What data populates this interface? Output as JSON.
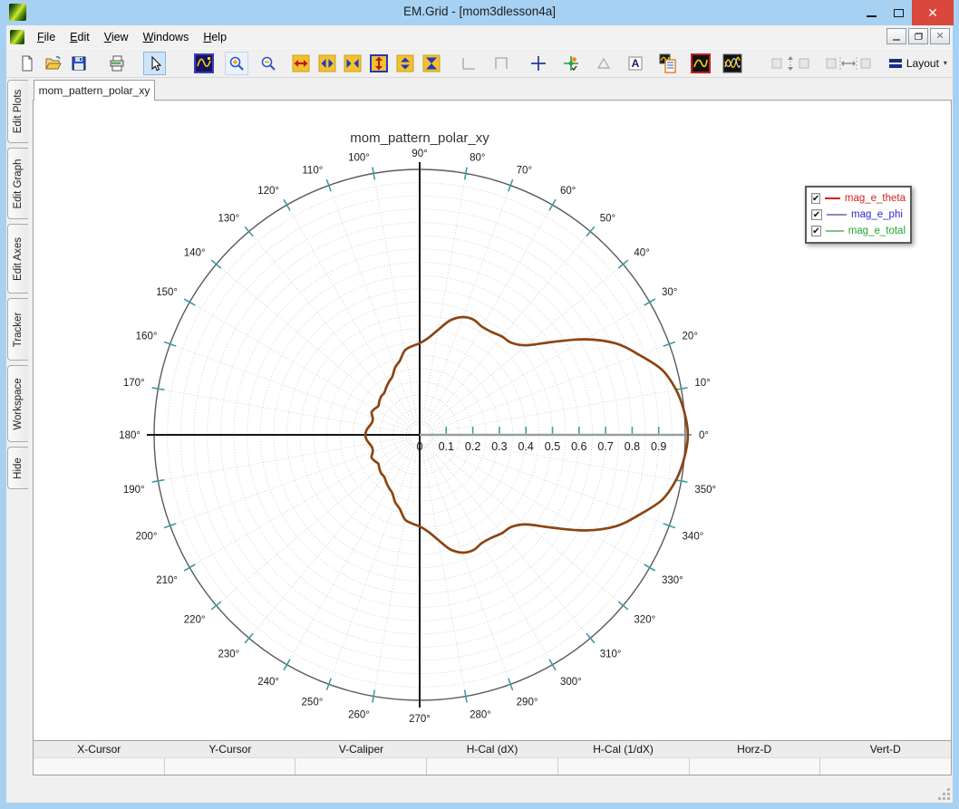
{
  "window": {
    "title": "EM.Grid - [mom3dlesson4a]"
  },
  "menubar": {
    "items": [
      "File",
      "Edit",
      "View",
      "Windows",
      "Help"
    ]
  },
  "toolbar": {
    "icons": [
      "new-file",
      "open-file",
      "save",
      "print",
      "pointer-tool",
      "fit-view",
      "zoom-in",
      "zoom-out",
      "expand-x",
      "pan-x",
      "compress-x",
      "expand-y",
      "pan-y",
      "compress-y",
      "corner-bottom-left",
      "corner-top",
      "crosshair",
      "tracker",
      "triangle",
      "text-annotation",
      "legend-list",
      "single-curve",
      "multi-curve",
      "y-scale-group",
      "x-scale-group"
    ],
    "layout_button": {
      "label": "Layout",
      "caret": "▾"
    }
  },
  "sidebar": {
    "items": [
      {
        "label": "Edit Plots"
      },
      {
        "label": "Edit Graph"
      },
      {
        "label": "Edit Axes"
      },
      {
        "label": "Tracker"
      },
      {
        "label": "Workspace"
      },
      {
        "label": "Hide"
      }
    ]
  },
  "document_tabs": {
    "active": "mom_pattern_polar_xy"
  },
  "legend": {
    "items": [
      {
        "label": "mag_e_theta",
        "checked": true,
        "check_glyph": "✔",
        "text_color": "#d42020",
        "line_color": "#dd1111"
      },
      {
        "label": "mag_e_phi",
        "checked": true,
        "check_glyph": "✔",
        "text_color": "#2a2ac8",
        "line_color": "#8a8abd"
      },
      {
        "label": "mag_e_total",
        "checked": true,
        "check_glyph": "✔",
        "text_color": "#1fa82f",
        "line_color": "#86c286"
      }
    ]
  },
  "readout": {
    "columns": [
      "X-Cursor",
      "Y-Cursor",
      "V-Caliper",
      "H-Cal (dX)",
      "H-Cal (1/dX)",
      "Horz-D",
      "Vert-D"
    ],
    "values": [
      "",
      "",
      "",
      "",
      "",
      "",
      ""
    ]
  },
  "chart_data": {
    "type": "line",
    "subtype": "polar",
    "title": "mom_pattern_polar_xy",
    "r_axis": {
      "min": 0,
      "max": 1.0,
      "tick_step": 0.1,
      "grid_step": 0.05,
      "tick_labels": [
        "0",
        "0.1",
        "0.2",
        "0.3",
        "0.4",
        "0.5",
        "0.6",
        "0.7",
        "0.8",
        "0.9"
      ]
    },
    "angle_axis": {
      "label_step_deg": 10,
      "grid_step_deg": 10,
      "labels_deg": [
        0,
        10,
        20,
        30,
        40,
        50,
        60,
        70,
        80,
        90,
        100,
        110,
        120,
        130,
        140,
        150,
        160,
        170,
        180,
        190,
        200,
        210,
        220,
        230,
        240,
        250,
        260,
        270,
        280,
        290,
        300,
        310,
        320,
        330,
        340,
        350
      ]
    },
    "series": [
      {
        "name": "mag_e_theta",
        "color": "#dd1111",
        "visible": true
      },
      {
        "name": "mag_e_phi",
        "color": "#8a8abd",
        "visible": true
      },
      {
        "name": "mag_e_total",
        "color": "#86c286",
        "visible": true
      }
    ],
    "drawn_curve_color": "#8b4513",
    "pattern_polar_points": {
      "comment_free": true,
      "angles_deg": [
        0,
        5,
        10,
        15,
        20,
        25,
        30,
        35,
        40,
        45,
        50,
        55,
        60,
        65,
        70,
        75,
        80,
        85,
        90,
        95,
        100,
        105,
        110,
        115,
        120,
        125,
        130,
        135,
        140,
        145,
        150,
        155,
        160,
        165,
        170,
        175,
        180
      ],
      "r": [
        1.01,
        1.0,
        0.98,
        0.945,
        0.88,
        0.815,
        0.72,
        0.61,
        0.525,
        0.49,
        0.483,
        0.473,
        0.47,
        0.479,
        0.472,
        0.447,
        0.402,
        0.366,
        0.345,
        0.335,
        0.323,
        0.289,
        0.27,
        0.243,
        0.231,
        0.219,
        0.207,
        0.205,
        0.198,
        0.19,
        0.196,
        0.2,
        0.188,
        0.185,
        0.192,
        0.201,
        0.204
      ],
      "mirror_lower_half": true
    },
    "style_colors": {
      "tick": "#3d9da3",
      "grid": "#cbcbcb",
      "outer_circle": "#5a5a5a",
      "main_axes": "#141414",
      "right_axis": "#97a0a0",
      "label": "#1a1a1a"
    }
  }
}
